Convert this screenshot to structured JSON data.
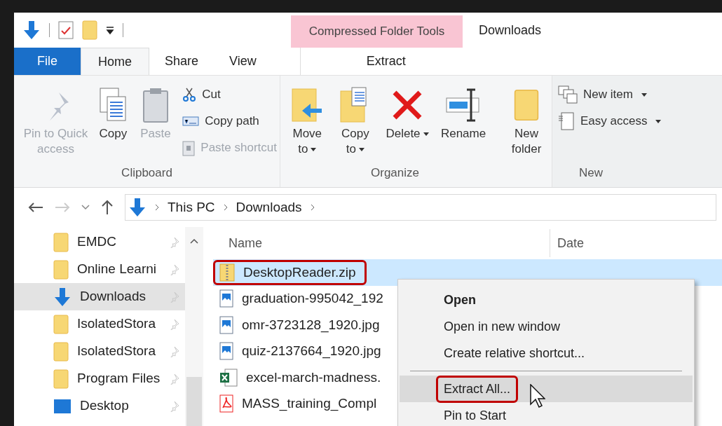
{
  "contextual_tab_group": {
    "label": "Compressed Folder Tools"
  },
  "window": {
    "title": "Downloads"
  },
  "ribbon_tabs": [
    {
      "label": "File",
      "kind": "file",
      "selected": false
    },
    {
      "label": "Home",
      "kind": "tab",
      "selected": true
    },
    {
      "label": "Share",
      "kind": "tab",
      "selected": false
    },
    {
      "label": "View",
      "kind": "tab",
      "selected": false
    },
    {
      "label": "Extract",
      "kind": "contextual",
      "selected": false
    }
  ],
  "ribbon_groups": [
    {
      "label": "Clipboard",
      "items": [
        {
          "label": "Pin to Quick access",
          "disabled": true,
          "dropdown": false
        },
        {
          "label": "Copy",
          "disabled": false,
          "dropdown": false
        },
        {
          "label": "Paste",
          "disabled": true,
          "dropdown": false
        },
        {
          "label": "Cut",
          "disabled": false,
          "dropdown": false
        },
        {
          "label": "Copy path",
          "disabled": false,
          "dropdown": false
        },
        {
          "label": "Paste shortcut",
          "disabled": true,
          "dropdown": false
        }
      ]
    },
    {
      "label": "Organize",
      "items": [
        {
          "label": "Move to",
          "disabled": false,
          "dropdown": true
        },
        {
          "label": "Copy to",
          "disabled": false,
          "dropdown": true
        },
        {
          "label": "Delete",
          "disabled": false,
          "dropdown": true
        },
        {
          "label": "Rename",
          "disabled": false,
          "dropdown": false
        }
      ]
    },
    {
      "label": "New",
      "items": [
        {
          "label": "New folder",
          "disabled": false,
          "dropdown": false
        },
        {
          "label": "New item",
          "disabled": false,
          "dropdown": true
        },
        {
          "label": "Easy access",
          "disabled": false,
          "dropdown": true
        }
      ]
    }
  ],
  "address_bar": {
    "crumbs": [
      "This PC",
      "Downloads"
    ]
  },
  "navigation_pane": {
    "items": [
      {
        "label": "EMDC",
        "kind": "folder",
        "pinned": true,
        "selected": false
      },
      {
        "label": "Online Learni",
        "kind": "folder",
        "pinned": true,
        "selected": false
      },
      {
        "label": "Downloads",
        "kind": "downloads",
        "pinned": true,
        "selected": true
      },
      {
        "label": "IsolatedStora",
        "kind": "folder",
        "pinned": true,
        "selected": false
      },
      {
        "label": "IsolatedStora",
        "kind": "folder",
        "pinned": true,
        "selected": false
      },
      {
        "label": "Program Files",
        "kind": "folder",
        "pinned": true,
        "selected": false
      },
      {
        "label": "Desktop",
        "kind": "desktop",
        "pinned": true,
        "selected": false
      }
    ]
  },
  "file_list": {
    "columns": [
      "Name",
      "Date"
    ],
    "rows": [
      {
        "name": "DesktopReader.zip",
        "kind": "zip",
        "selected": true,
        "annotated": true
      },
      {
        "name": "graduation-995042_192",
        "kind": "image",
        "selected": false,
        "annotated": false
      },
      {
        "name": "omr-3723128_1920.jpg",
        "kind": "image",
        "selected": false,
        "annotated": false
      },
      {
        "name": "quiz-2137664_1920.jpg",
        "kind": "image",
        "selected": false,
        "annotated": false
      },
      {
        "name": "excel-march-madness.",
        "kind": "excel",
        "selected": false,
        "annotated": false
      },
      {
        "name": "MASS_training_Compl",
        "kind": "pdf",
        "selected": false,
        "annotated": false
      }
    ]
  },
  "context_menu": {
    "items": [
      {
        "label": "Open",
        "default": true,
        "separator_before": false,
        "selected": false,
        "annotated": false
      },
      {
        "label": "Open in new window",
        "default": false,
        "separator_before": false,
        "selected": false,
        "annotated": false
      },
      {
        "label": "Create relative shortcut...",
        "default": false,
        "separator_before": false,
        "selected": false,
        "annotated": false
      },
      {
        "label": "Extract All...",
        "default": false,
        "separator_before": true,
        "selected": true,
        "annotated": true
      },
      {
        "label": "Pin to Start",
        "default": false,
        "separator_before": false,
        "selected": false,
        "annotated": false
      }
    ]
  }
}
